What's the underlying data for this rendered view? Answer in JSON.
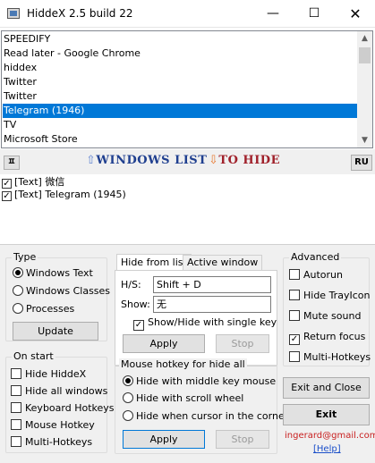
{
  "window": {
    "title": "HiddeX 2.5 build 22",
    "min_glyph": "—",
    "max_glyph": "☐",
    "close_glyph": "✕"
  },
  "app_list": {
    "items": [
      {
        "label": "SPEEDIFY",
        "selected": false
      },
      {
        "label": "Read later - Google Chrome",
        "selected": false
      },
      {
        "label": "hiddex",
        "selected": false
      },
      {
        "label": "Twitter",
        "selected": false
      },
      {
        "label": "Twitter",
        "selected": false
      },
      {
        "label": "Telegram (1946)",
        "selected": true
      },
      {
        "label": "TV",
        "selected": false
      },
      {
        "label": "Microsoft Store",
        "selected": false
      }
    ],
    "scroll_up": "▲",
    "scroll_down": "▼"
  },
  "toolbar": {
    "sort_label": "ㅍ",
    "up_arrow": "⇧",
    "windows_list_label": "WINDOWS LIST",
    "down_arrow": "⇩",
    "to_hide_label": "TO HIDE",
    "lang_label": "RU"
  },
  "hidden_list": {
    "items": [
      {
        "label": "[Text] 微信",
        "checked": true
      },
      {
        "label": "[Text] Telegram (1945)",
        "checked": true
      }
    ]
  },
  "type_group": {
    "title": "Type",
    "options": [
      {
        "label": "Windows Text",
        "selected": true
      },
      {
        "label": "Windows Classes",
        "selected": false
      },
      {
        "label": "Processes",
        "selected": false
      }
    ],
    "update_button": "Update"
  },
  "onstart_group": {
    "title": "On start",
    "options": [
      {
        "label": "Hide HiddeX",
        "checked": false
      },
      {
        "label": "Hide all windows",
        "checked": false
      },
      {
        "label": "Keyboard Hotkeys",
        "checked": false
      },
      {
        "label": "Mouse Hotkey",
        "checked": false
      },
      {
        "label": "Multi-Hotkeys",
        "checked": false
      }
    ]
  },
  "hide_tabs": {
    "tabs": [
      "Hide from list",
      "Active window"
    ],
    "hs_label": "H/S:",
    "hs_value": "Shift + D",
    "show_label": "Show:",
    "show_value": "无",
    "single_key_label": "Show/Hide with single key",
    "single_key_checked": true,
    "apply_button": "Apply",
    "stop_button": "Stop"
  },
  "mouse_group": {
    "title": "Mouse hotkey for hide all",
    "options": [
      {
        "label": "Hide with middle key mouse",
        "selected": true
      },
      {
        "label": "Hide with scroll wheel",
        "selected": false
      },
      {
        "label": "Hide when cursor in the corner",
        "selected": false
      }
    ],
    "apply_button": "Apply",
    "stop_button": "Stop"
  },
  "advanced_group": {
    "title": "Advanced",
    "options": [
      {
        "label": "Autorun",
        "checked": false
      },
      {
        "label": "Hide TrayIcon",
        "checked": false
      },
      {
        "label": "Mute sound",
        "checked": false
      },
      {
        "label": "Return focus",
        "checked": true
      },
      {
        "label": "Multi-Hotkeys",
        "checked": false
      }
    ]
  },
  "actions": {
    "exit_close": "Exit and Close",
    "exit": "Exit"
  },
  "footer": {
    "user": "ingerard@gmail.com",
    "help": "[Help]"
  }
}
